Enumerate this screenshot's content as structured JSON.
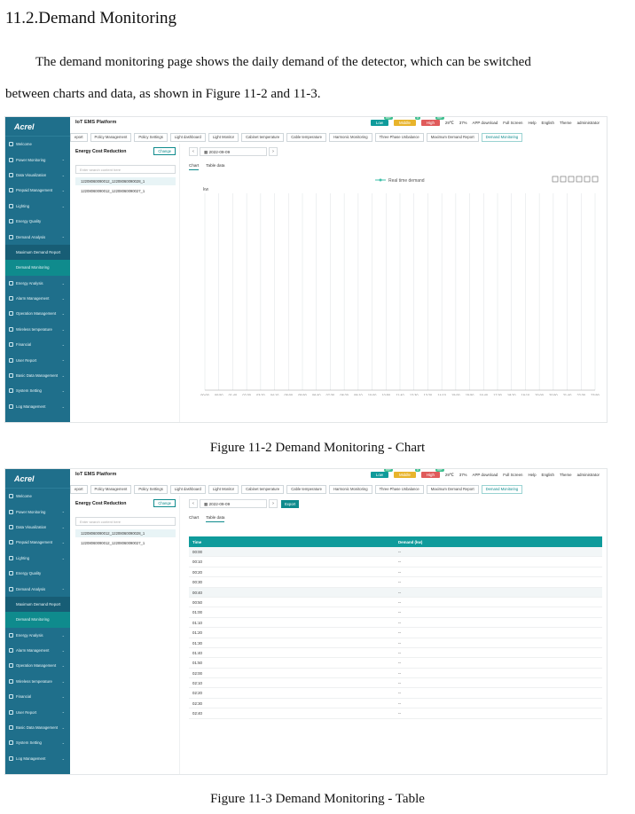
{
  "doc": {
    "heading": "11.2.Demand Monitoring",
    "para_line1": "The demand monitoring page shows the daily demand of the detector, which can be switched",
    "para_line2": "between charts and data, as shown in Figure 11-2 and 11-3.",
    "caption1": "Figure 11-2 Demand Monitoring - Chart",
    "caption2": "Figure 11-3 Demand Monitoring - Table"
  },
  "app": {
    "logo": "Acrel",
    "platform": "IoT EMS Platform",
    "badges": [
      {
        "label": "Low",
        "count": "99+",
        "color": "#0f9b9b"
      },
      {
        "label": "Middle",
        "count": "0",
        "color": "#e8b42c"
      },
      {
        "label": "High",
        "count": "99+",
        "color": "#e05b5b"
      }
    ],
    "temp": "29℃",
    "humidity": "37%",
    "app_download": "APP download",
    "full_screen": "Full Screen",
    "help": "Help",
    "lang": "English",
    "theme": "Theme",
    "user": "administrator",
    "sidebar": [
      "Welcome",
      "Power Monitoring",
      "Data Visualization",
      "Prepaid Management",
      "Lighting",
      "Energy Quality",
      "Demand Analysis",
      "Maximum Demand Report",
      "Demand Monitoring",
      "Energy Analysis",
      "Alarm Management",
      "Operation Management",
      "Wireless temperature",
      "Financial",
      "User Report",
      "Basic Data Management",
      "System Setting",
      "Log Management"
    ],
    "tabs": [
      "eport",
      "Policy Management",
      "Policy Settings",
      "Light dashboard",
      "Light Monitor",
      "Cabinet temperature",
      "Cable temperature",
      "Harmonic Monitoring",
      "Three Phase Unbalance",
      "Maximum Demand Report",
      "Demand Monitoring"
    ],
    "left_title": "Energy Cost Reduction",
    "change": "Change",
    "search_placeholder": "Enter search content here",
    "devices": [
      "12208060090012_12208060090028_1",
      "12208060090012_12208060090027_1"
    ],
    "date": "2022-09-09",
    "export": "Export",
    "view_tab_chart": "Chart",
    "view_tab_table": "Table data"
  },
  "chart_data": {
    "type": "line",
    "ylabel": "kw",
    "legend": "Real time demand",
    "legend_position": "top-center",
    "categories": [
      "00:00",
      "00:50",
      "01:40",
      "02:30",
      "03:20",
      "04:10",
      "05:00",
      "05:50",
      "06:40",
      "07:30",
      "08:20",
      "09:10",
      "10:00",
      "10:50",
      "11:40",
      "12:30",
      "13:20",
      "14:10",
      "15:00",
      "15:50",
      "16:40",
      "17:30",
      "18:20",
      "19:10",
      "20:00",
      "20:50",
      "21:40",
      "22:30",
      "23:50"
    ],
    "series": [
      {
        "name": "Real time demand",
        "values": []
      }
    ],
    "grid": true
  },
  "table": {
    "headers": [
      "Time",
      "Demand (kw)"
    ],
    "rows": [
      [
        "00:00",
        "--"
      ],
      [
        "00:10",
        "--"
      ],
      [
        "00:20",
        "--"
      ],
      [
        "00:30",
        "--"
      ],
      [
        "00:40",
        "--"
      ],
      [
        "00:50",
        "--"
      ],
      [
        "01:00",
        "--"
      ],
      [
        "01:10",
        "--"
      ],
      [
        "01:20",
        "--"
      ],
      [
        "01:30",
        "--"
      ],
      [
        "01:40",
        "--"
      ],
      [
        "01:50",
        "--"
      ],
      [
        "02:00",
        "--"
      ],
      [
        "02:10",
        "--"
      ],
      [
        "02:20",
        "--"
      ],
      [
        "02:30",
        "--"
      ],
      [
        "02:40",
        "--"
      ]
    ]
  }
}
